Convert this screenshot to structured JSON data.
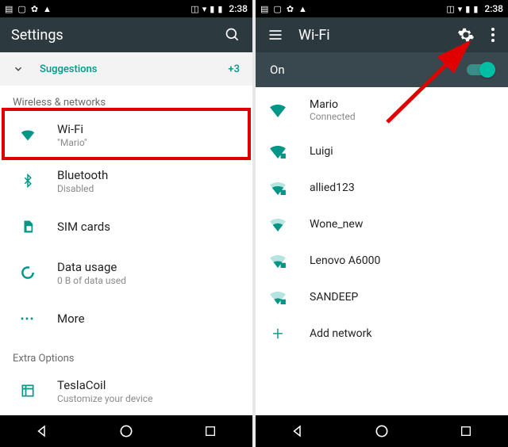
{
  "status": {
    "time": "2:38"
  },
  "left": {
    "title": "Settings",
    "suggestions": {
      "label": "Suggestions",
      "count": "+3"
    },
    "section1": "Wireless & networks",
    "wifi": {
      "label": "Wi-Fi",
      "sub": "\"Mario\""
    },
    "bluetooth": {
      "label": "Bluetooth",
      "sub": "Disabled"
    },
    "sim": {
      "label": "SIM cards"
    },
    "data": {
      "label": "Data usage",
      "sub": "0 B of data used"
    },
    "more": {
      "label": "More"
    },
    "section2": "Extra Options",
    "tesla": {
      "label": "TeslaCoil",
      "sub": "Customize your device"
    }
  },
  "right": {
    "title": "Wi-Fi",
    "state": "On",
    "nets": {
      "mario": {
        "name": "Mario",
        "sub": "Connected"
      },
      "luigi": "Luigi",
      "allied": "allied123",
      "wone": "Wone_new",
      "lenovo": "Lenovo A6000",
      "sandeep": "SANDEEP",
      "add": "Add network"
    }
  }
}
